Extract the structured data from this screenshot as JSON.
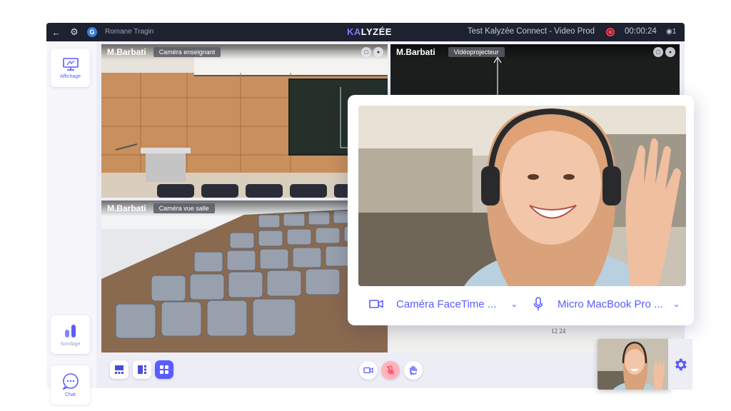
{
  "topbar": {
    "user_initial": "G",
    "user_name": "Romane Tragin",
    "logo_left": "KA",
    "logo_right": "LYZÉE",
    "session_title": "Test Kalyzée Connect - Video Prod",
    "timer": "00:00:24",
    "viewers": "1",
    "icons": [
      "back-arrow-icon",
      "gear-icon",
      "record-icon",
      "eye-icon"
    ]
  },
  "sidebar": {
    "items": [
      {
        "label": "Affichage",
        "icon": "monitor-icon"
      },
      {
        "label": "Sondage",
        "icon": "bar-chart-icon"
      },
      {
        "label": "Chat",
        "icon": "chat-bubble-icon"
      }
    ]
  },
  "tiles": [
    {
      "name": "M.Barbati",
      "label": "Caméra enseignant"
    },
    {
      "name": "M.Barbati",
      "label": "Vidéoprojecteur"
    },
    {
      "name": "M.Barbati",
      "label": "Caméra vue salle"
    }
  ],
  "device_popup": {
    "camera": "Caméra FaceTime ...",
    "microphone": "Micro MacBook Pro ..."
  },
  "controls": {
    "layouts": [
      "layout-rows-icon",
      "layout-split-icon",
      "layout-grid-icon"
    ],
    "buttons": [
      "camera-icon",
      "mic-muted-icon",
      "raise-hand-icon"
    ]
  },
  "colors": {
    "accent": "#5a5cff",
    "topbar": "#1d2130",
    "record": "#ff3b4a"
  }
}
